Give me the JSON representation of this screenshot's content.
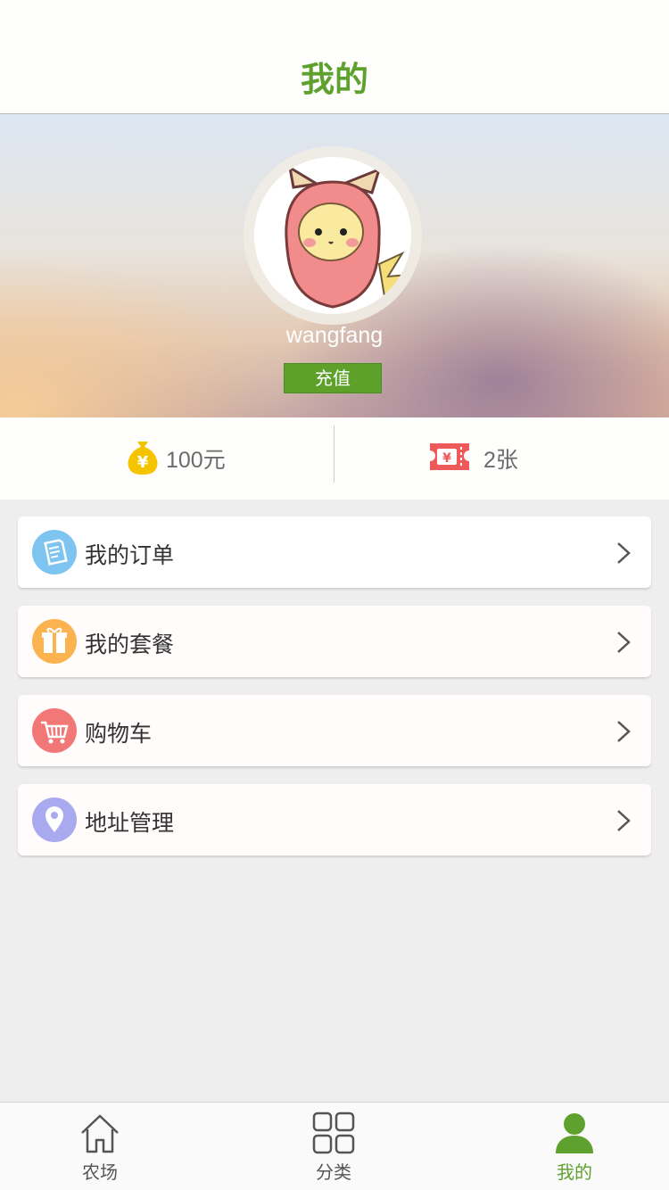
{
  "header": {
    "title": "我的"
  },
  "profile": {
    "username": "wangfang",
    "recharge_label": "充值"
  },
  "stats": {
    "balance": "100元",
    "coupons": "2张"
  },
  "menu": [
    {
      "label": "我的订单",
      "icon": "order-icon",
      "color": "#7ec4f0"
    },
    {
      "label": "我的套餐",
      "icon": "gift-icon",
      "color": "#fbb34f"
    },
    {
      "label": "购物车",
      "icon": "cart-icon",
      "color": "#f27777"
    },
    {
      "label": "地址管理",
      "icon": "location-icon",
      "color": "#a9a9ef"
    }
  ],
  "tabs": [
    {
      "label": "农场",
      "icon": "home-icon",
      "active": false
    },
    {
      "label": "分类",
      "icon": "grid-icon",
      "active": false
    },
    {
      "label": "我的",
      "icon": "user-icon",
      "active": true
    }
  ],
  "colors": {
    "accent": "#5fa12f"
  }
}
